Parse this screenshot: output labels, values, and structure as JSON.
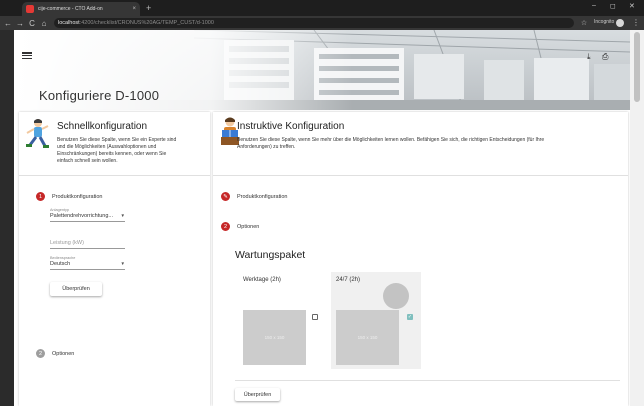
{
  "browser": {
    "tab_title": "cije-commerce - CTO Add-on",
    "tab_close": "×",
    "new_tab": "+",
    "url_host": "localhost",
    "url_path": ":4200/checklist/CRONUS%20AG/TEMP_CUST/d-1000",
    "incognito_label": "Incognito",
    "nav_back": "←",
    "nav_forward": "→",
    "nav_reload": "C",
    "nav_home": "⌂",
    "star": "☆",
    "minimize": "–",
    "maximize": "◻",
    "close": "✕",
    "menu": "⋮"
  },
  "header": {
    "title": "Konfiguriere D-1000",
    "download_icon": "⤓",
    "print_icon": "⎙"
  },
  "quick": {
    "title": "Schnellkonfiguration",
    "description_lines": [
      "Benutzen Sie diese Spalte, wenn Sie ein Experte sind",
      "und die Möglichkeiten (Auswahloptionen und",
      "Einschränkungen) bereits kennen, oder wenn Sie",
      "einfach schnell sein wollen."
    ],
    "steps": [
      {
        "number": "1",
        "label": "Produktkonfiguration"
      },
      {
        "number": "2",
        "label": "Optionen"
      }
    ],
    "fields": {
      "anlagentyp_label": "Anlagentyp",
      "anlagentyp_value": "Palettendrehvorrichtung...",
      "leistung_placeholder": "Leistung (kW)",
      "sprache_label": "Bediensprache",
      "sprache_value": "Deutsch",
      "caret": "▼"
    },
    "check_button": "Überprüfen"
  },
  "guided": {
    "title": "Instruktive Konfiguration",
    "description_lines": [
      "Benutzen Sie diese Spalte, wenn Sie mehr über die Möglichkeiten lernen wollen. Befähigen Sie sich, die richtigen Entscheidungen (für Ihre",
      "Anforderungen) zu treffen."
    ],
    "steps": [
      {
        "icon": "✎",
        "label": "Produktkonfiguration"
      },
      {
        "number": "2",
        "label": "Optionen"
      }
    ],
    "package": {
      "title": "Wartungspaket",
      "options": [
        {
          "name": "Werktage (2h)",
          "image_text": "150 x 150",
          "checked": false
        },
        {
          "name": "24/7 (2h)",
          "image_text": "150 x 150",
          "checked": true
        }
      ],
      "check_mark": "✓"
    },
    "check_button": "Überprüfen"
  },
  "colors": {
    "step_active": "#c62828",
    "step_inactive": "#9e9e9e",
    "checkbox_checked": "#7fbfbe",
    "placeholder_gray": "#cccccc"
  }
}
